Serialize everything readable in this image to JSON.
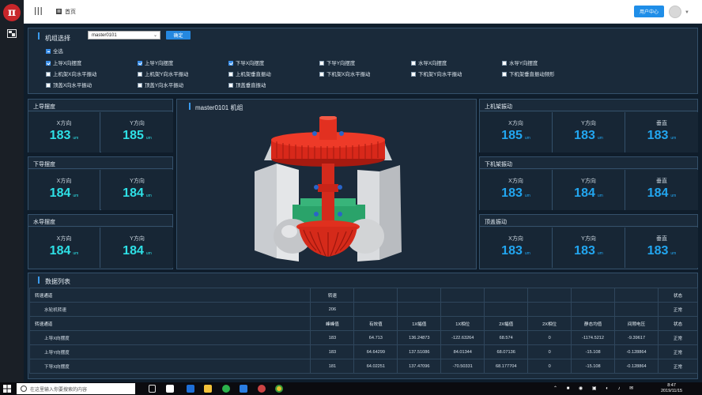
{
  "header": {
    "home_label": "首页",
    "user_center": "用户中心",
    "logo_text": "π"
  },
  "unit_select": {
    "title": "机组选择",
    "selected": "master0101",
    "confirm": "确定",
    "select_all": "全选",
    "options": [
      {
        "label": "上导X向摆度",
        "checked": true
      },
      {
        "label": "上导Y向摆度",
        "checked": true
      },
      {
        "label": "下导X向摆度",
        "checked": true
      },
      {
        "label": "下导Y向摆度",
        "checked": false
      },
      {
        "label": "水导X向摆度",
        "checked": false
      },
      {
        "label": "水导Y向摆度",
        "checked": false
      },
      {
        "label": "上机架X向水平振动",
        "checked": false
      },
      {
        "label": "上机架Y向水平振动",
        "checked": false
      },
      {
        "label": "上机架垂直振动",
        "checked": false
      },
      {
        "label": "下机架X向水平振动",
        "checked": false
      },
      {
        "label": "下机架Y向水平振动",
        "checked": false
      },
      {
        "label": "下机架垂直振动频形",
        "checked": false
      },
      {
        "label": "顶盖X向水平振动",
        "checked": false
      },
      {
        "label": "顶盖Y向水平振动",
        "checked": false
      },
      {
        "label": "顶盖垂直振动",
        "checked": false
      }
    ]
  },
  "left_panels": [
    {
      "title": "上导摆度",
      "cells": [
        {
          "label": "X方向",
          "value": "183",
          "unit": "um"
        },
        {
          "label": "Y方向",
          "value": "185",
          "unit": "um"
        }
      ]
    },
    {
      "title": "下导摆度",
      "cells": [
        {
          "label": "X方向",
          "value": "184",
          "unit": "um"
        },
        {
          "label": "Y方向",
          "value": "184",
          "unit": "um"
        }
      ]
    },
    {
      "title": "水导摆度",
      "cells": [
        {
          "label": "X方向",
          "value": "184",
          "unit": "um"
        },
        {
          "label": "Y方向",
          "value": "184",
          "unit": "um"
        }
      ]
    }
  ],
  "right_panels": [
    {
      "title": "上机架振动",
      "cells": [
        {
          "label": "X方向",
          "value": "185",
          "unit": "um"
        },
        {
          "label": "Y方向",
          "value": "183",
          "unit": "um"
        },
        {
          "label": "垂直",
          "value": "183",
          "unit": "um"
        }
      ]
    },
    {
      "title": "下机架振动",
      "cells": [
        {
          "label": "X方向",
          "value": "183",
          "unit": "um"
        },
        {
          "label": "Y方向",
          "value": "184",
          "unit": "um"
        },
        {
          "label": "垂直",
          "value": "184",
          "unit": "um"
        }
      ]
    },
    {
      "title": "顶盖振动",
      "cells": [
        {
          "label": "X方向",
          "value": "183",
          "unit": "um"
        },
        {
          "label": "Y方向",
          "value": "183",
          "unit": "um"
        },
        {
          "label": "垂直",
          "value": "183",
          "unit": "um"
        }
      ]
    }
  ],
  "model": {
    "title": "master0101 机组"
  },
  "data_list": {
    "title": "数据列表",
    "rows": [
      {
        "section": true,
        "cells": [
          "转速通道",
          "转速",
          "",
          "",
          "",
          "",
          "",
          "",
          "",
          "状态"
        ]
      },
      {
        "section": false,
        "cells": [
          "水轮机转速",
          "206",
          "",
          "",
          "",
          "",
          "",
          "",
          "",
          "正常"
        ]
      },
      {
        "section": true,
        "cells": [
          "转速通道",
          "峰峰值",
          "有效值",
          "1X幅值",
          "1X相位",
          "2X幅值",
          "2X相位",
          "静态均值",
          "间隙电压",
          "状态"
        ]
      },
      {
        "section": false,
        "cells": [
          "上导X向摆度",
          "183",
          "64.713",
          "136.24873",
          "-122.63264",
          "68.574",
          "0",
          "-1174.5212",
          "-9.39617",
          "正常"
        ]
      },
      {
        "section": false,
        "cells": [
          "上导Y向摆度",
          "183",
          "64.64299",
          "137.51086",
          "84.01344",
          "68.07136",
          "0",
          "-15.108",
          "-0.128864",
          "正常"
        ]
      },
      {
        "section": false,
        "cells": [
          "下导X向摆度",
          "181",
          "64.02251",
          "137.47096",
          "-70.50331",
          "68.177704",
          "0",
          "-15.108",
          "-0.128864",
          "正常"
        ]
      }
    ]
  },
  "taskbar": {
    "search_placeholder": "在这里输入你要搜索的内容",
    "time": "8:47",
    "date": "2019/11/15"
  }
}
